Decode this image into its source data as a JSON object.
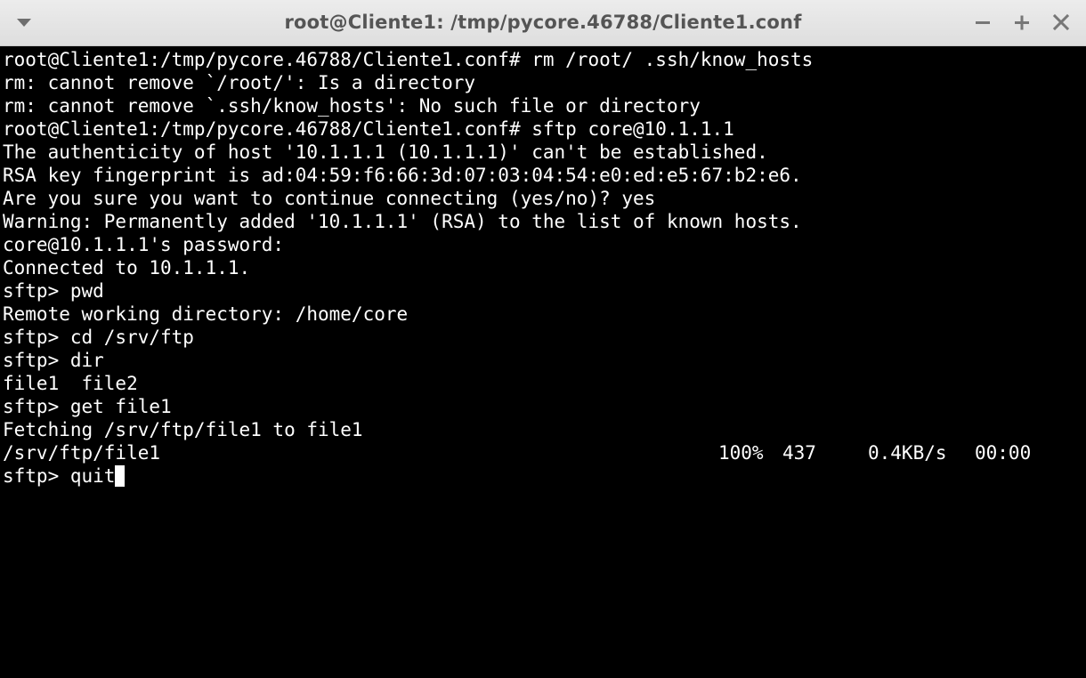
{
  "window": {
    "title": "root@Cliente1: /tmp/pycore.46788/Cliente1.conf",
    "icons": {
      "menu": "chevron-down-icon",
      "minimize": "minimize-icon",
      "maximize": "maximize-icon",
      "close": "close-icon"
    }
  },
  "terminal": {
    "lines": [
      "root@Cliente1:/tmp/pycore.46788/Cliente1.conf# rm /root/ .ssh/know_hosts",
      "rm: cannot remove `/root/': Is a directory",
      "rm: cannot remove `.ssh/know_hosts': No such file or directory",
      "root@Cliente1:/tmp/pycore.46788/Cliente1.conf# sftp core@10.1.1.1",
      "The authenticity of host '10.1.1.1 (10.1.1.1)' can't be established.",
      "RSA key fingerprint is ad:04:59:f6:66:3d:07:03:04:54:e0:ed:e5:67:b2:e6.",
      "Are you sure you want to continue connecting (yes/no)? yes",
      "Warning: Permanently added '10.1.1.1' (RSA) to the list of known hosts.",
      "core@10.1.1.1's password:",
      "Connected to 10.1.1.1.",
      "sftp> pwd",
      "Remote working directory: /home/core",
      "sftp> cd /srv/ftp",
      "sftp> dir",
      "file1  file2",
      "sftp> get file1",
      "Fetching /srv/ftp/file1 to file1"
    ],
    "progress": {
      "file": "/srv/ftp/file1",
      "percent": "100%",
      "size": "437",
      "rate": "0.4KB/s",
      "eta": "00:00"
    },
    "prompt": "sftp> ",
    "current_input": "quit"
  }
}
